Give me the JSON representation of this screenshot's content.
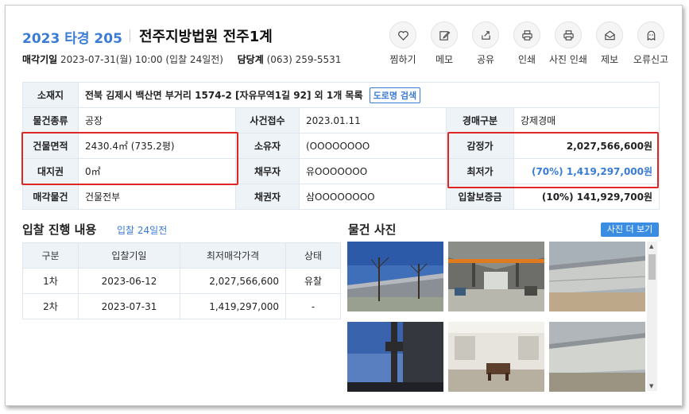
{
  "header": {
    "case_number": "2023 타경 205",
    "court": "전주지방법원 전주1계",
    "sale_date_label": "매각기일",
    "sale_date_value": "2023-07-31(월) 10:00 (입찰 24일전)",
    "manager_label": "담당계",
    "manager_phone": "(063) 259-5531"
  },
  "actions": [
    {
      "label": "찜하기",
      "icon": "heart-icon"
    },
    {
      "label": "메모",
      "icon": "edit-icon"
    },
    {
      "label": "공유",
      "icon": "share-icon"
    },
    {
      "label": "인쇄",
      "icon": "print-icon"
    },
    {
      "label": "사진 인쇄",
      "icon": "print-icon"
    },
    {
      "label": "제보",
      "icon": "mail-icon"
    },
    {
      "label": "오류신고",
      "icon": "ghost-icon"
    }
  ],
  "info": {
    "location_label": "소재지",
    "location_value": "전북 김제시 백산면 부거리 1574-2 [자유무역1길 92] 외 1개 목록",
    "road_btn": "도로명 검색",
    "type_label": "물건종류",
    "type_value": "공장",
    "received_label": "사건접수",
    "received_value": "2023.01.11",
    "auction_kind_label": "경매구분",
    "auction_kind_value": "강제경매",
    "building_area_label": "건물면적",
    "building_area_value": "2430.4㎡ (735.2평)",
    "owner_label": "소유자",
    "owner_value": "(OOOOOOOO",
    "appraisal_label": "감정가",
    "appraisal_value": "2,027,566,600원",
    "land_right_label": "대지권",
    "land_right_value": "0㎡",
    "debtor_label": "채무자",
    "debtor_value": "유OOOOOOO",
    "min_price_label": "최저가",
    "min_price_value": "(70%) 1,419,297,000원",
    "sale_item_label": "매각물건",
    "sale_item_value": "건물전부",
    "creditor_label": "채권자",
    "creditor_value": "삼OOOOOOOO",
    "deposit_label": "입찰보증금",
    "deposit_value": "(10%) 141,929,700원"
  },
  "progress": {
    "title": "입찰 진행 내용",
    "subtitle": "입찰 24일전",
    "headers": [
      "구분",
      "입찰기일",
      "최저매각가격",
      "상태"
    ],
    "rows": [
      [
        "1차",
        "2023-06-12",
        "2,027,566,600",
        "유찰"
      ],
      [
        "2차",
        "2023-07-31",
        "1,419,297,000",
        "-"
      ]
    ]
  },
  "photos": {
    "title": "물건 사진",
    "more_btn": "사진 더 보기"
  },
  "colors": {
    "accent": "#3a7bd5",
    "highlight": "#e02525",
    "header_cell": "#eef3f8"
  }
}
